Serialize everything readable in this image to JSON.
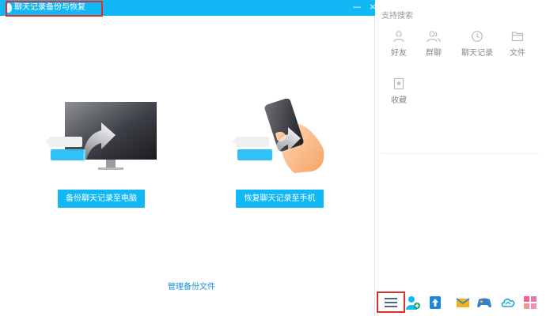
{
  "dialog": {
    "title": "聊天记录备份与恢复",
    "minimize_label": "—",
    "close_label": "×",
    "backup_button": "备份聊天记录至电脑",
    "restore_button": "恢复聊天记录至手机",
    "manage_link": "管理备份文件"
  },
  "search_panel": {
    "title": "支持搜索",
    "categories": [
      {
        "label": "好友",
        "icon": "person-icon"
      },
      {
        "label": "群聊",
        "icon": "group-icon"
      },
      {
        "label": "聊天记录",
        "icon": "clock-icon"
      },
      {
        "label": "文件",
        "icon": "folder-icon"
      },
      {
        "label": "收藏",
        "icon": "bookmark-icon"
      }
    ]
  },
  "bottom_bar": {
    "icons": [
      "menu-icon",
      "add-contact-icon",
      "upload-icon",
      "mail-icon",
      "game-icon",
      "cloud-icon",
      "apps-grid-icon"
    ]
  },
  "colors": {
    "titlebar": "#12b7f5",
    "button": "#12b7f5",
    "highlight": "#d9302c",
    "link": "#1a8fd6"
  }
}
